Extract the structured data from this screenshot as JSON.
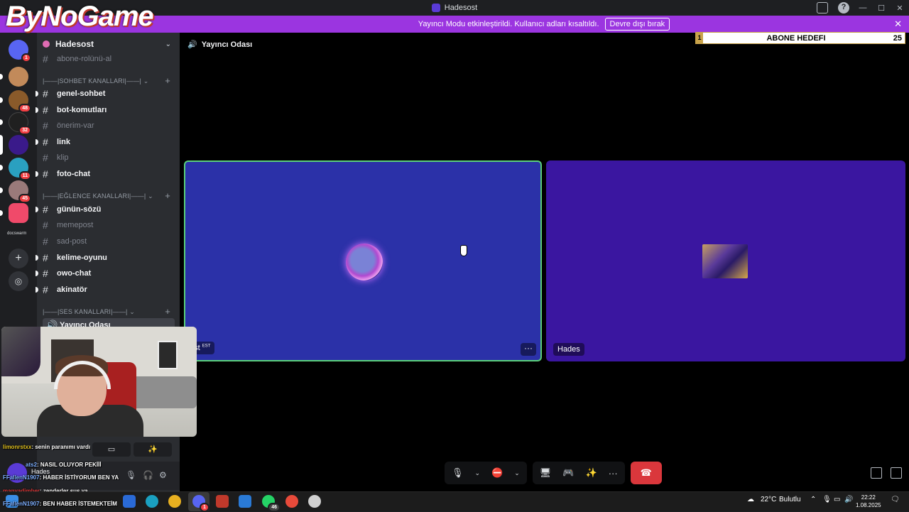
{
  "window": {
    "title": "Hadesost"
  },
  "overlay": {
    "logo_text": "ByNoGame",
    "goal": {
      "left": "1",
      "label": "ABONE HEDEFI",
      "count": "25"
    }
  },
  "notice": {
    "text": "Yayıncı Modu etkinleştirildi. Kullanıcı adları kısaltıldı.",
    "button": "Devre dışı bırak"
  },
  "guilds": [
    {
      "badge": "1",
      "color": "#5865f2"
    },
    {
      "badge": "",
      "color": "#c28a5a"
    },
    {
      "badge": "48",
      "color": "#8a5a2a"
    },
    {
      "badge": "32",
      "color": "#202020"
    },
    {
      "badge": "",
      "color": "#3a1a8a"
    },
    {
      "badge": "11",
      "color": "#2aa0c0"
    },
    {
      "badge": "45",
      "color": "#9a7a7a"
    },
    {
      "badge": "",
      "color": "#f04a6a"
    }
  ],
  "server": {
    "name": "Hadesost",
    "top_channel": "abone-rolünü-al",
    "categories": {
      "sohbet": "|——|SOHBET KANALLARI|——|",
      "eglence": "|——|EĞLENCE KANALLARI|——|",
      "ses": "|——|SES KANALLARI|——|"
    },
    "channels": {
      "genel_sohbet": "genel-sohbet",
      "bot_komutlari": "bot-komutları",
      "onerim_var": "önerim-var",
      "link": "link",
      "klip": "klip",
      "foto_chat": "foto-chat",
      "gunun_sozu": "günün-sözü",
      "memepost": "memepost",
      "sad_post": "sad-post",
      "kelime_oyunu": "kelime-oyunu",
      "owo_chat": "owo-chat",
      "akinator": "akinatör"
    },
    "voice_channel": "Yayıncı Odası",
    "docs_label": "docswarm"
  },
  "voice": {
    "header": "Yayıncı Odası",
    "tile1_name": "ust",
    "tile1_tag": "EST",
    "tile2_name": "Hades"
  },
  "user_panel": {
    "name": "Hades"
  },
  "chat": [
    {
      "user": "limonrstxx",
      "text": ": senin paranımı vardı"
    },
    {
      "user": "ats2",
      "text": ": NASIL OLUYOR PEKİİİ"
    },
    {
      "user": "FFallenN1907",
      "text": ": HABER İSTİYORUM BEN YA"
    },
    {
      "user": "manyadimber",
      "text": ": zenderler sus ya"
    },
    {
      "user": "FFallenN1907",
      "text": ": BEN HABER İSTEMEKTEİM"
    }
  ],
  "taskbar": {
    "discord_badge": "1",
    "whatsapp_badge": "46",
    "weather": "22°C",
    "weather_desc": "Bulutlu",
    "time": "22:22",
    "date": "1.08.2025"
  }
}
